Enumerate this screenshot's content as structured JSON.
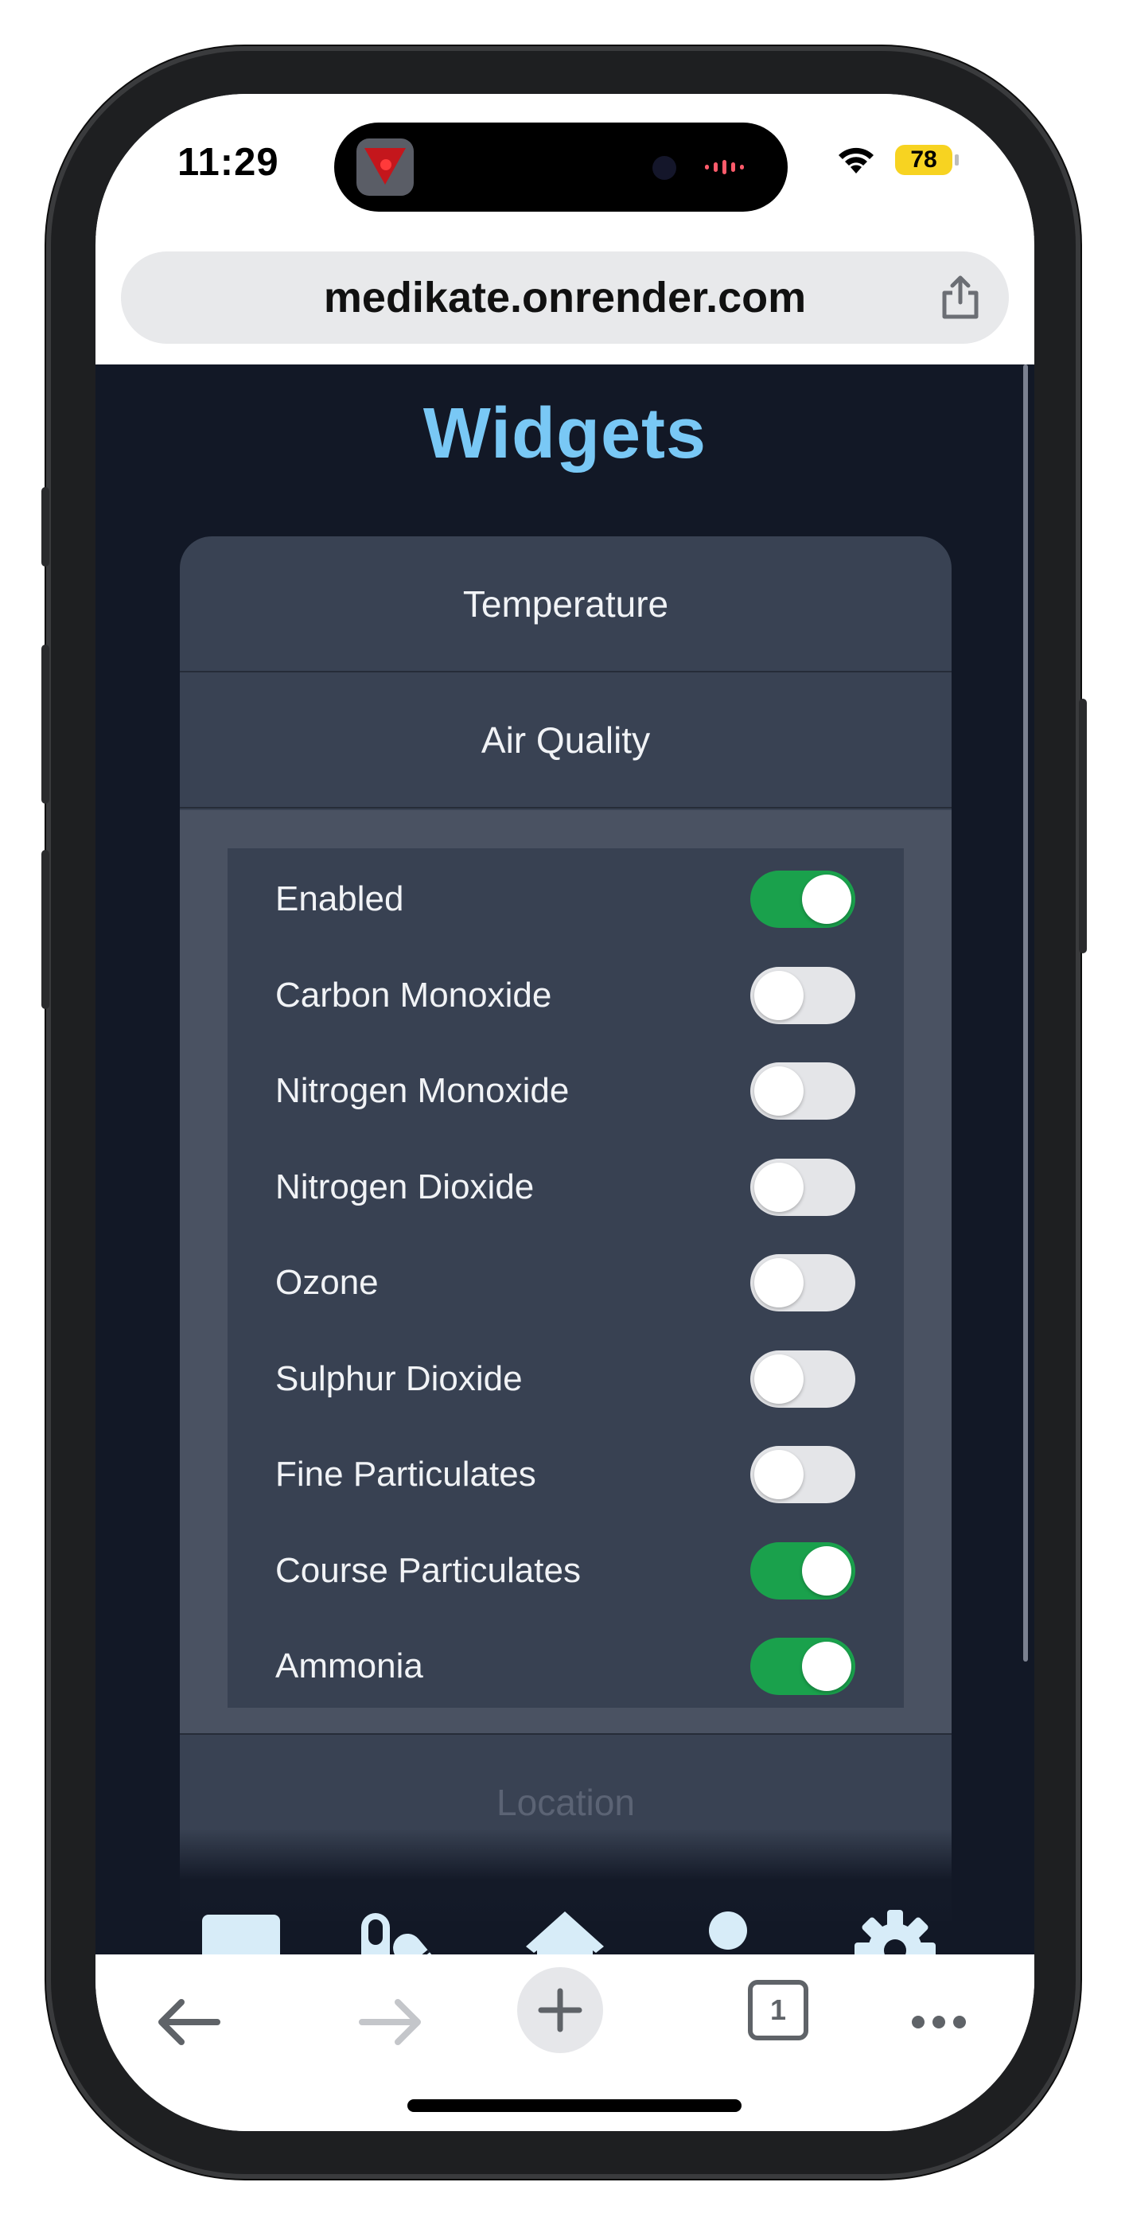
{
  "status_bar": {
    "time": "11:29",
    "battery": "78",
    "icons": [
      "wifi-icon",
      "battery-icon",
      "app-activity-icon",
      "audio-wave-icon"
    ]
  },
  "browser": {
    "url": "medikate.onrender.com",
    "share_icon": "share-icon",
    "toolbar": {
      "back_icon": "back-arrow-icon",
      "forward_icon": "forward-arrow-icon",
      "new_tab_icon": "plus-icon",
      "tab_count": "1",
      "more_icon": "more-dots-icon"
    }
  },
  "page": {
    "title": "Widgets",
    "sections": [
      {
        "label": "Temperature"
      },
      {
        "label": "Air Quality"
      },
      {
        "label": "Location"
      }
    ],
    "air_quality_toggles": [
      {
        "label": "Enabled",
        "on": true
      },
      {
        "label": "Carbon Monoxide",
        "on": false
      },
      {
        "label": "Nitrogen Monoxide",
        "on": false
      },
      {
        "label": "Nitrogen Dioxide",
        "on": false
      },
      {
        "label": "Ozone",
        "on": false
      },
      {
        "label": "Sulphur Dioxide",
        "on": false
      },
      {
        "label": "Fine Particulates",
        "on": false
      },
      {
        "label": "Course Particulates",
        "on": true
      },
      {
        "label": "Ammonia",
        "on": true
      }
    ],
    "bottom_nav": [
      {
        "icon": "chat-icon"
      },
      {
        "icon": "pills-icon"
      },
      {
        "icon": "home-icon"
      },
      {
        "icon": "user-icon"
      },
      {
        "icon": "gear-icon"
      }
    ]
  },
  "colors": {
    "page_bg": "#121826",
    "accent_title": "#79c8f5",
    "panel": "#394253",
    "toggle_on": "#1aa14c",
    "toggle_off": "#e4e5e8",
    "nav_icon": "#d7ecf8"
  }
}
